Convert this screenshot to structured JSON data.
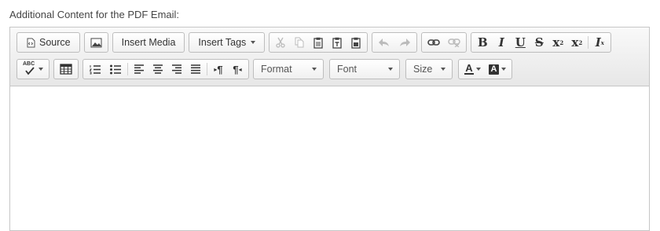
{
  "field": {
    "label": "Additional Content for the PDF Email:"
  },
  "toolbar": {
    "source_label": "Source",
    "insert_media_label": "Insert Media",
    "insert_tags_label": "Insert Tags",
    "format_label": "Format",
    "font_label": "Font",
    "size_label": "Size",
    "bold_glyph": "B",
    "italic_glyph": "I",
    "underline_glyph": "U",
    "strike_glyph": "S",
    "subscript_glyph": "x",
    "subscript_mark": "2",
    "superscript_glyph": "x",
    "superscript_mark": "2",
    "remove_format_glyph": "I",
    "remove_format_mark": "x",
    "text_color_glyph": "A",
    "bg_color_glyph": "A",
    "ltr_glyph": "¶",
    "rtl_glyph": "¶",
    "spellcheck_glyph": "ABC"
  },
  "editor": {
    "content": ""
  }
}
